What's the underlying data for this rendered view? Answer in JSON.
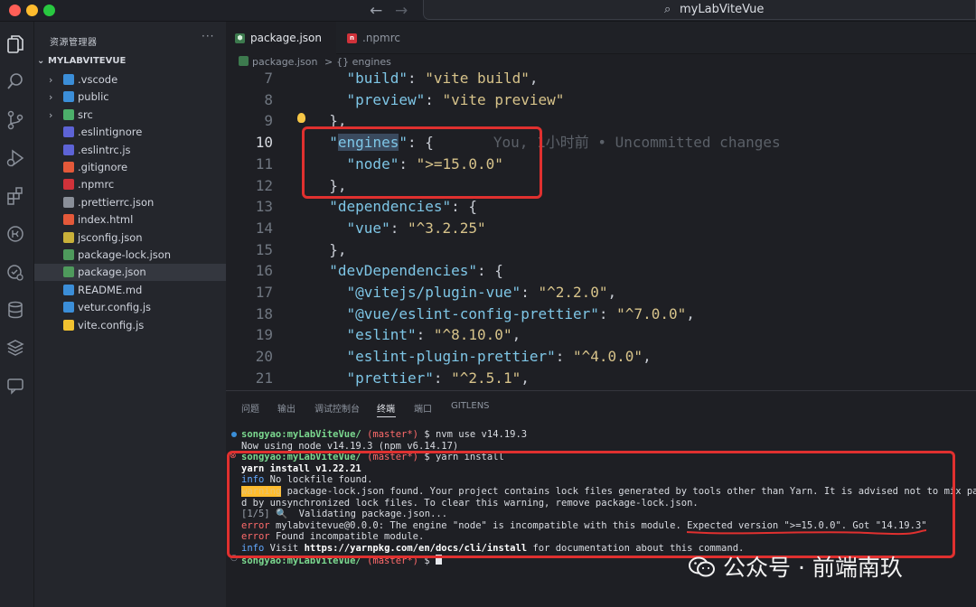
{
  "window": {
    "title": "myLabViteVue"
  },
  "explorer": {
    "title": "资源管理器",
    "more": "···",
    "root_label": "MYLABVITEVUE",
    "items": [
      {
        "label": ".vscode",
        "type": "folder",
        "icon": "folder-vscode-icon",
        "color": "#3b8ed8"
      },
      {
        "label": "public",
        "type": "folder",
        "icon": "folder-public-icon",
        "color": "#3b8ed8"
      },
      {
        "label": "src",
        "type": "folder",
        "icon": "folder-src-icon",
        "color": "#4caf6a"
      },
      {
        "label": ".eslintignore",
        "type": "file",
        "icon": "eslint-icon",
        "color": "#5d63d6"
      },
      {
        "label": ".eslintrc.js",
        "type": "file",
        "icon": "eslint-icon",
        "color": "#5d63d6"
      },
      {
        "label": ".gitignore",
        "type": "file",
        "icon": "git-icon",
        "color": "#e4593a"
      },
      {
        "label": ".npmrc",
        "type": "file",
        "icon": "npm-icon",
        "color": "#d0323a"
      },
      {
        "label": ".prettierrc.json",
        "type": "file",
        "icon": "prettier-icon",
        "color": "#8a8f99"
      },
      {
        "label": "index.html",
        "type": "file",
        "icon": "html-icon",
        "color": "#e4593a"
      },
      {
        "label": "jsconfig.json",
        "type": "file",
        "icon": "json-config-icon",
        "color": "#c9b13a"
      },
      {
        "label": "package-lock.json",
        "type": "file",
        "icon": "nodejs-icon",
        "color": "#4e9a5c"
      },
      {
        "label": "package.json",
        "type": "file",
        "icon": "nodejs-icon",
        "color": "#4e9a5c",
        "selected": true
      },
      {
        "label": "README.md",
        "type": "file",
        "icon": "info-icon",
        "color": "#3b8ed8"
      },
      {
        "label": "vetur.config.js",
        "type": "file",
        "icon": "vetur-icon",
        "color": "#3b8ed8"
      },
      {
        "label": "vite.config.js",
        "type": "file",
        "icon": "vite-icon",
        "color": "#f2c230"
      }
    ]
  },
  "tabs": [
    {
      "label": "package.json",
      "active": true,
      "icon": "nodejs-icon"
    },
    {
      "label": ".npmrc",
      "active": false,
      "icon": "npm-icon"
    }
  ],
  "breadcrumb": {
    "file": "package.json",
    "sep": ">",
    "symbol": "{} engines"
  },
  "code": {
    "lines": [
      {
        "n": "7",
        "text": "    \"build\": \"vite build\","
      },
      {
        "n": "8",
        "text": "    \"preview\": \"vite preview\""
      },
      {
        "n": "9",
        "text": "  },"
      },
      {
        "n": "10",
        "text": "  \"engines\": {",
        "blame": "You, 1小时前 • Uncommitted changes"
      },
      {
        "n": "11",
        "text": "    \"node\": \">=15.0.0\""
      },
      {
        "n": "12",
        "text": "  },"
      },
      {
        "n": "13",
        "text": "  \"dependencies\": {"
      },
      {
        "n": "14",
        "text": "    \"vue\": \"^3.2.25\""
      },
      {
        "n": "15",
        "text": "  },"
      },
      {
        "n": "16",
        "text": "  \"devDependencies\": {"
      },
      {
        "n": "17",
        "text": "    \"@vitejs/plugin-vue\": \"^2.2.0\","
      },
      {
        "n": "18",
        "text": "    \"@vue/eslint-config-prettier\": \"^7.0.0\","
      },
      {
        "n": "19",
        "text": "    \"eslint\": \"^8.10.0\","
      },
      {
        "n": "20",
        "text": "    \"eslint-plugin-prettier\": \"^4.0.0\","
      },
      {
        "n": "21",
        "text": "    \"prettier\": \"^2.5.1\","
      }
    ]
  },
  "panel": {
    "tabs": [
      "问题",
      "输出",
      "调试控制台",
      "终端",
      "端口",
      "GITLENS"
    ],
    "active_tab": "终端"
  },
  "terminal": {
    "prompt_user": "songyao:myLabViteVue/",
    "prompt_branch": "(master*)",
    "prompt_char": "$",
    "lines": {
      "cmd1": "nvm use v14.19.3",
      "out1": "Now using node v14.19.3 (npm v6.14.17)",
      "cmd2": "yarn install",
      "yarn_version": "yarn install v1.22.21",
      "info_label": "info",
      "info_text": "No lockfile found.",
      "warning_label": "warning",
      "warning_text": "package-lock.json found. Your project contains lock files generated by tools other than Yarn. It is advised not to mix pa",
      "warning_cont": "d by unsynchronized lock files. To clear this warning, remove package-lock.json.",
      "step": "[1/5]",
      "step_text": "Validating package.json...",
      "error_label": "error",
      "error_text": "mylabvitevue@0.0.0: The engine \"node\" is incompatible with this module. Expected version \">=15.0.0\". Got \"14.19.3\"",
      "error2_text": "Found incompatible module.",
      "visit_label": "info",
      "visit_pre": "Visit",
      "visit_url": "https://yarnpkg.com/en/docs/cli/install",
      "visit_post": "for documentation about this command."
    }
  },
  "watermark": {
    "text": "公众号 · 前端南玖"
  },
  "colors": {
    "accent_red": "#e0302f",
    "key": "#7ec6e6",
    "string": "#d7c38a"
  }
}
